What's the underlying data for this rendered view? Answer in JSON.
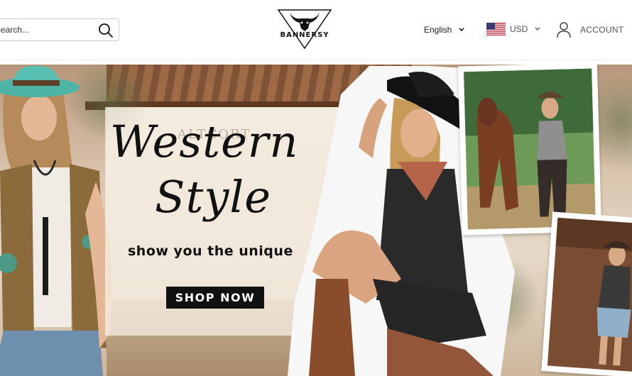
{
  "search": {
    "placeholder": "Search...",
    "button_icon": "search-icon"
  },
  "logo": {
    "text": "BANNERSY",
    "icon": "bull-skull-logo"
  },
  "language": {
    "selected": "English",
    "icon": "chevron-down-icon"
  },
  "currency": {
    "selected": "USD",
    "flag_icon": "us-flag-icon",
    "icon": "chevron-down-icon"
  },
  "account": {
    "label": "ACCOUNT",
    "icon": "user-icon"
  },
  "hero": {
    "title_line1": "Western",
    "title_line2": "Style",
    "subtitle": "show you the unique",
    "cta_label": "SHOP NOW",
    "background_sign": "ALTCORT"
  },
  "colors": {
    "accent": "#111111",
    "cta_bg": "#111111",
    "cta_text": "#ffffff"
  }
}
